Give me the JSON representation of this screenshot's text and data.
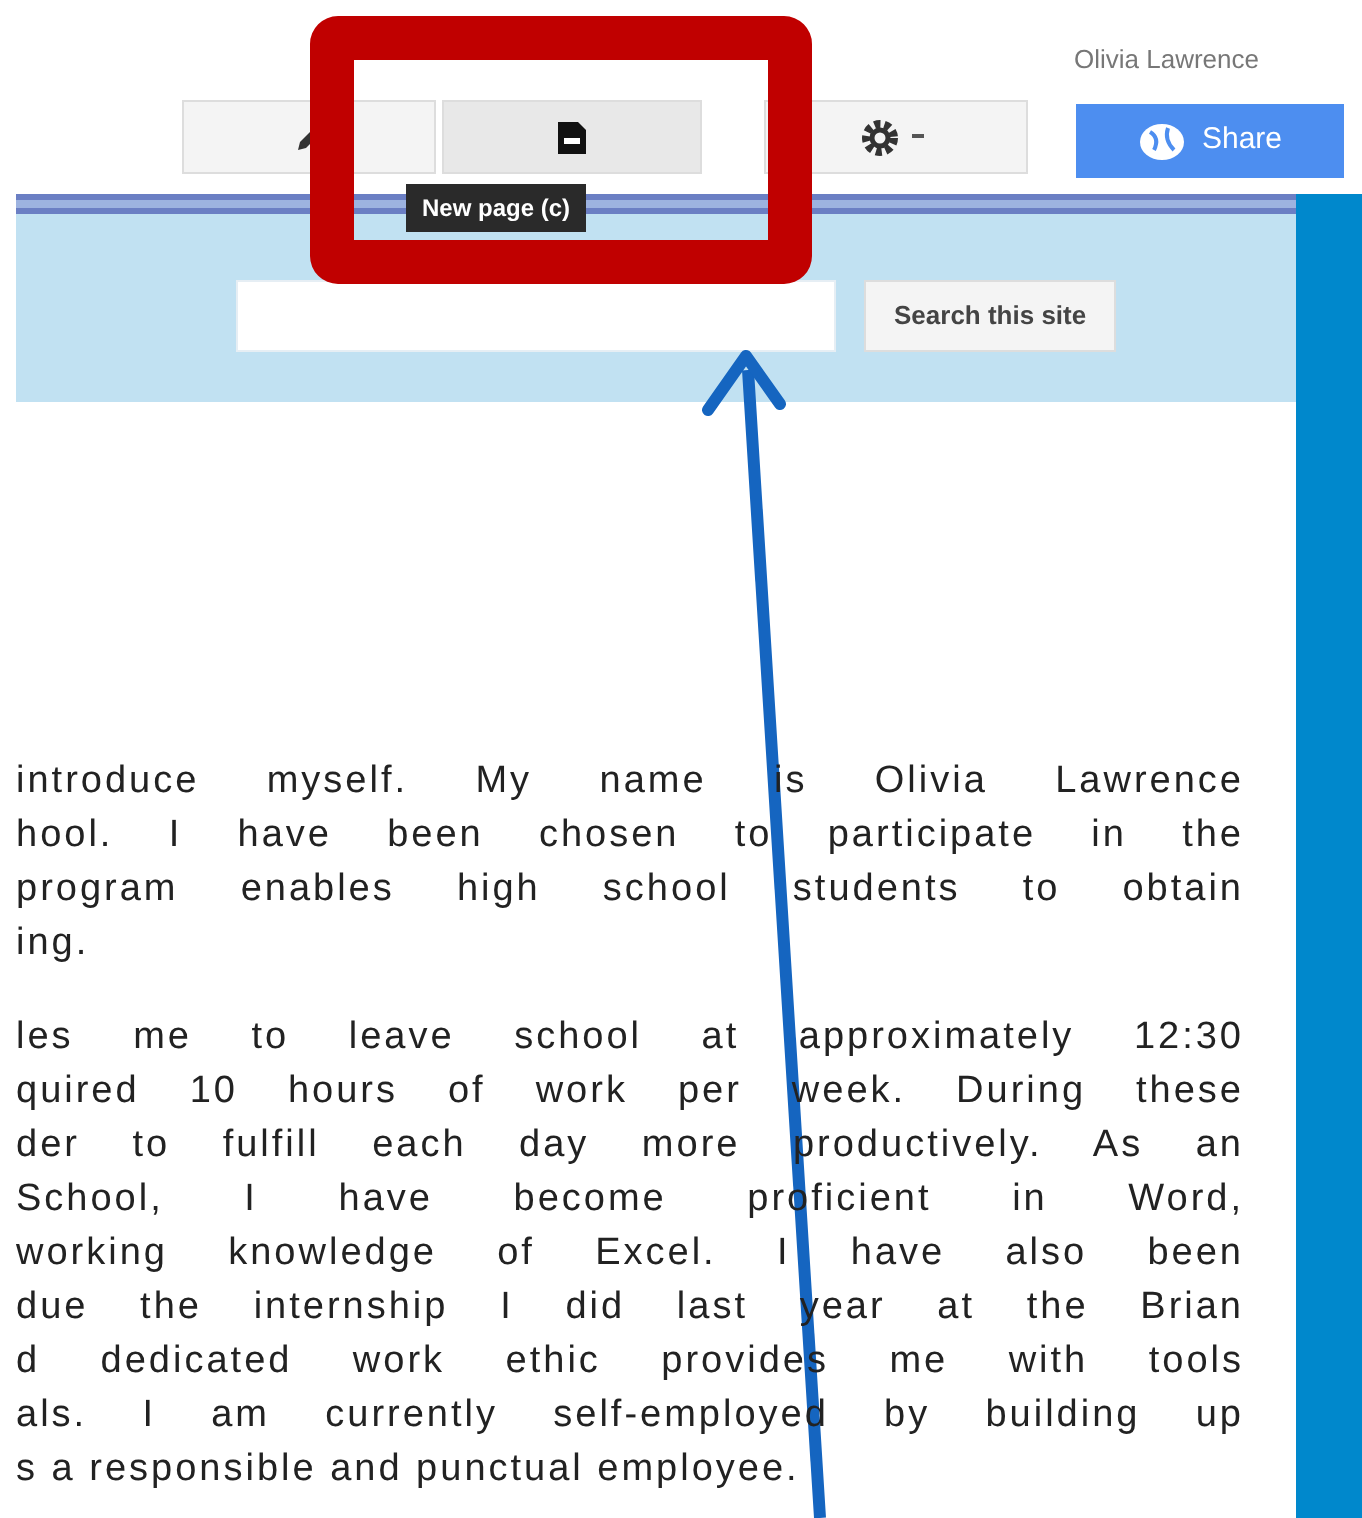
{
  "user": {
    "name": "Olivia Lawrence"
  },
  "toolbar": {
    "buttons": [
      {
        "kind": "edit",
        "selected": false
      },
      {
        "kind": "new-page",
        "selected": true
      },
      {
        "kind": "settings",
        "selected": false
      }
    ],
    "tooltip": "New page (c)",
    "share_button": "Share"
  },
  "search": {
    "button": "Search this site"
  },
  "paragraphs": [
    {
      "lines": [
        "introduce myself.  My name is Olivia Lawrence",
        "hool.  I have been chosen to participate in the",
        "program enables high school students to obtain",
        "ing."
      ]
    },
    {
      "lines": [
        "les me to leave school at approximately 12:30",
        "quired 10 hours of work per week. During these",
        "der to fulfill each day more productively. As an",
        "School, I  have  become  proficient  in Word,",
        "working knowledge of Excel. I have also been",
        "due the internship I did last year at the Brian",
        "d dedicated work ethic provides me with tools",
        "als. I am currently self-employed by building up",
        "s a responsible and punctual employee."
      ]
    }
  ]
}
